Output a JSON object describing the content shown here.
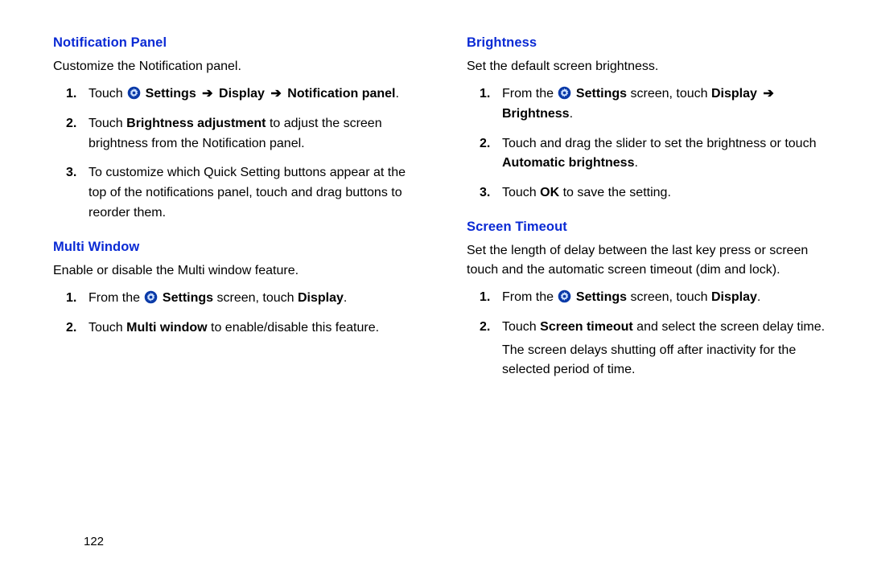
{
  "page_number": "122",
  "arrow": "➔",
  "left": {
    "sec1": {
      "heading": "Notification Panel",
      "desc": "Customize the Notification panel.",
      "steps": [
        {
          "pre": "Touch ",
          "path1": "Settings",
          "path2": "Display",
          "path3": "Notification panel",
          "post": "."
        },
        {
          "pre": "Touch ",
          "bold1": "Brightness adjustment",
          "post": " to adjust the screen brightness from the Notification panel."
        },
        {
          "text": "To customize which Quick Setting buttons appear at the top of the notifications panel, touch and drag buttons to reorder them."
        }
      ]
    },
    "sec2": {
      "heading": "Multi Window",
      "desc": "Enable or disable the Multi window feature.",
      "steps": [
        {
          "pre": "From the ",
          "bold1": "Settings",
          "mid": " screen, touch ",
          "bold2": "Display",
          "post": "."
        },
        {
          "pre": "Touch ",
          "bold1": "Multi window",
          "post": " to enable/disable this feature."
        }
      ]
    }
  },
  "right": {
    "sec1": {
      "heading": "Brightness",
      "desc": "Set the default screen brightness.",
      "steps": [
        {
          "pre": "From the ",
          "bold1": "Settings",
          "mid": " screen, touch ",
          "bold2": "Display",
          "arrow_after": true,
          "bold3": "Brightness",
          "post": "."
        },
        {
          "pre": "Touch and drag the slider to set the brightness or touch ",
          "bold1": "Automatic brightness",
          "post": "."
        },
        {
          "pre": "Touch ",
          "bold1": "OK",
          "post": " to save the setting."
        }
      ]
    },
    "sec2": {
      "heading": "Screen Timeout",
      "desc": "Set the length of delay between the last key press or screen touch and the automatic screen timeout (dim and lock).",
      "steps": [
        {
          "pre": "From the ",
          "bold1": "Settings",
          "mid": " screen, touch ",
          "bold2": "Display",
          "post": "."
        },
        {
          "pre": "Touch ",
          "bold1": "Screen timeout",
          "post": " and select the screen delay time.",
          "trail": "The screen delays shutting off after inactivity for the selected period of time."
        }
      ]
    }
  }
}
